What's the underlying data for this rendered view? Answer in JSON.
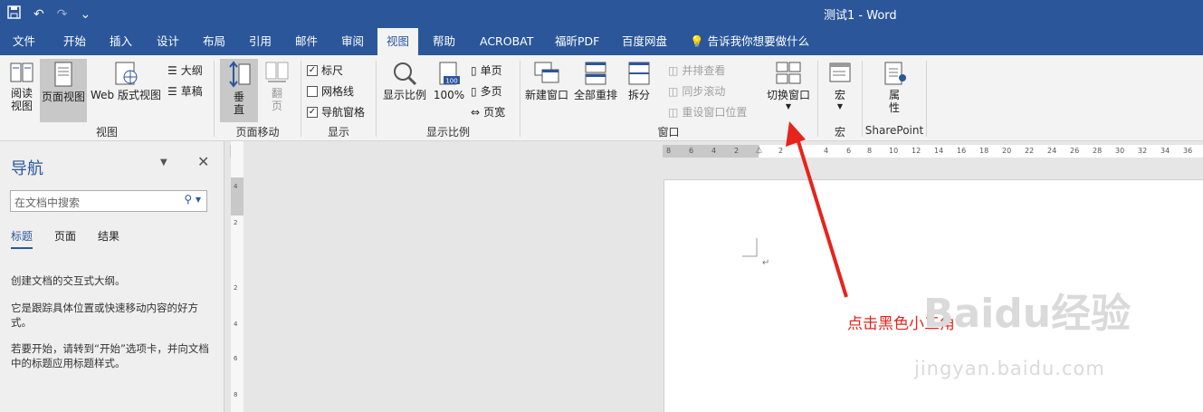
{
  "window": {
    "title": "测试1  -  Word"
  },
  "qat": {
    "save_icon": "save-icon",
    "undo": "↶",
    "redo": "↷",
    "more": "⌄"
  },
  "tabs": [
    "文件",
    "开始",
    "插入",
    "设计",
    "布局",
    "引用",
    "邮件",
    "审阅",
    "视图",
    "帮助",
    "ACROBAT",
    "福昕PDF",
    "百度网盘",
    "告诉我你想要做什么"
  ],
  "ribbon": {
    "views": {
      "read": "阅读\n视图",
      "print": "页面视图",
      "web": "Web 版式视图",
      "outline": "大纲",
      "draft": "草稿",
      "group": "视图"
    },
    "pagemove": {
      "vertical": "垂\n直",
      "side": "翻\n页",
      "group": "页面移动"
    },
    "show": {
      "ruler": "标尺",
      "gridlines": "网格线",
      "navpane": "导航窗格",
      "group": "显示"
    },
    "zoom": {
      "zoom": "显示比例",
      "hundred": "100%",
      "onepage": "单页",
      "multipage": "多页",
      "pagewidth": "页宽",
      "group": "显示比例"
    },
    "window": {
      "newwin": "新建窗口",
      "arrange": "全部重排",
      "split": "拆分",
      "sidebyside": "并排查看",
      "syncscroll": "同步滚动",
      "resetpos": "重设窗口位置",
      "switch": "切换窗口",
      "group": "窗口"
    },
    "macros": {
      "macro": "宏",
      "group": "宏"
    },
    "sharepoint": {
      "props": "属\n性",
      "group": "SharePoint"
    }
  },
  "navpane": {
    "title": "导航",
    "search_placeholder": "在文档中搜索",
    "tabs": [
      "标题",
      "页面",
      "结果"
    ],
    "text1": "创建文档的交互式大纲。",
    "text2": "它是跟踪具体位置或快速移动内容的好方式。",
    "text3": "若要开始，请转到“开始”选项卡，并向文档中的标题应用标题样式。"
  },
  "ruler": {
    "h": [
      "8",
      "6",
      "4",
      "2",
      "2",
      "4",
      "6",
      "8",
      "10",
      "12",
      "14",
      "16",
      "18",
      "20",
      "22",
      "24",
      "26",
      "28",
      "30",
      "32",
      "34",
      "36",
      "38"
    ],
    "v": [
      "4",
      "2",
      "2",
      "4",
      "6",
      "8"
    ]
  },
  "annotation": "点击黑色小三角",
  "watermark": {
    "main": "Baidu经验",
    "url": "jingyan.baidu.com"
  }
}
